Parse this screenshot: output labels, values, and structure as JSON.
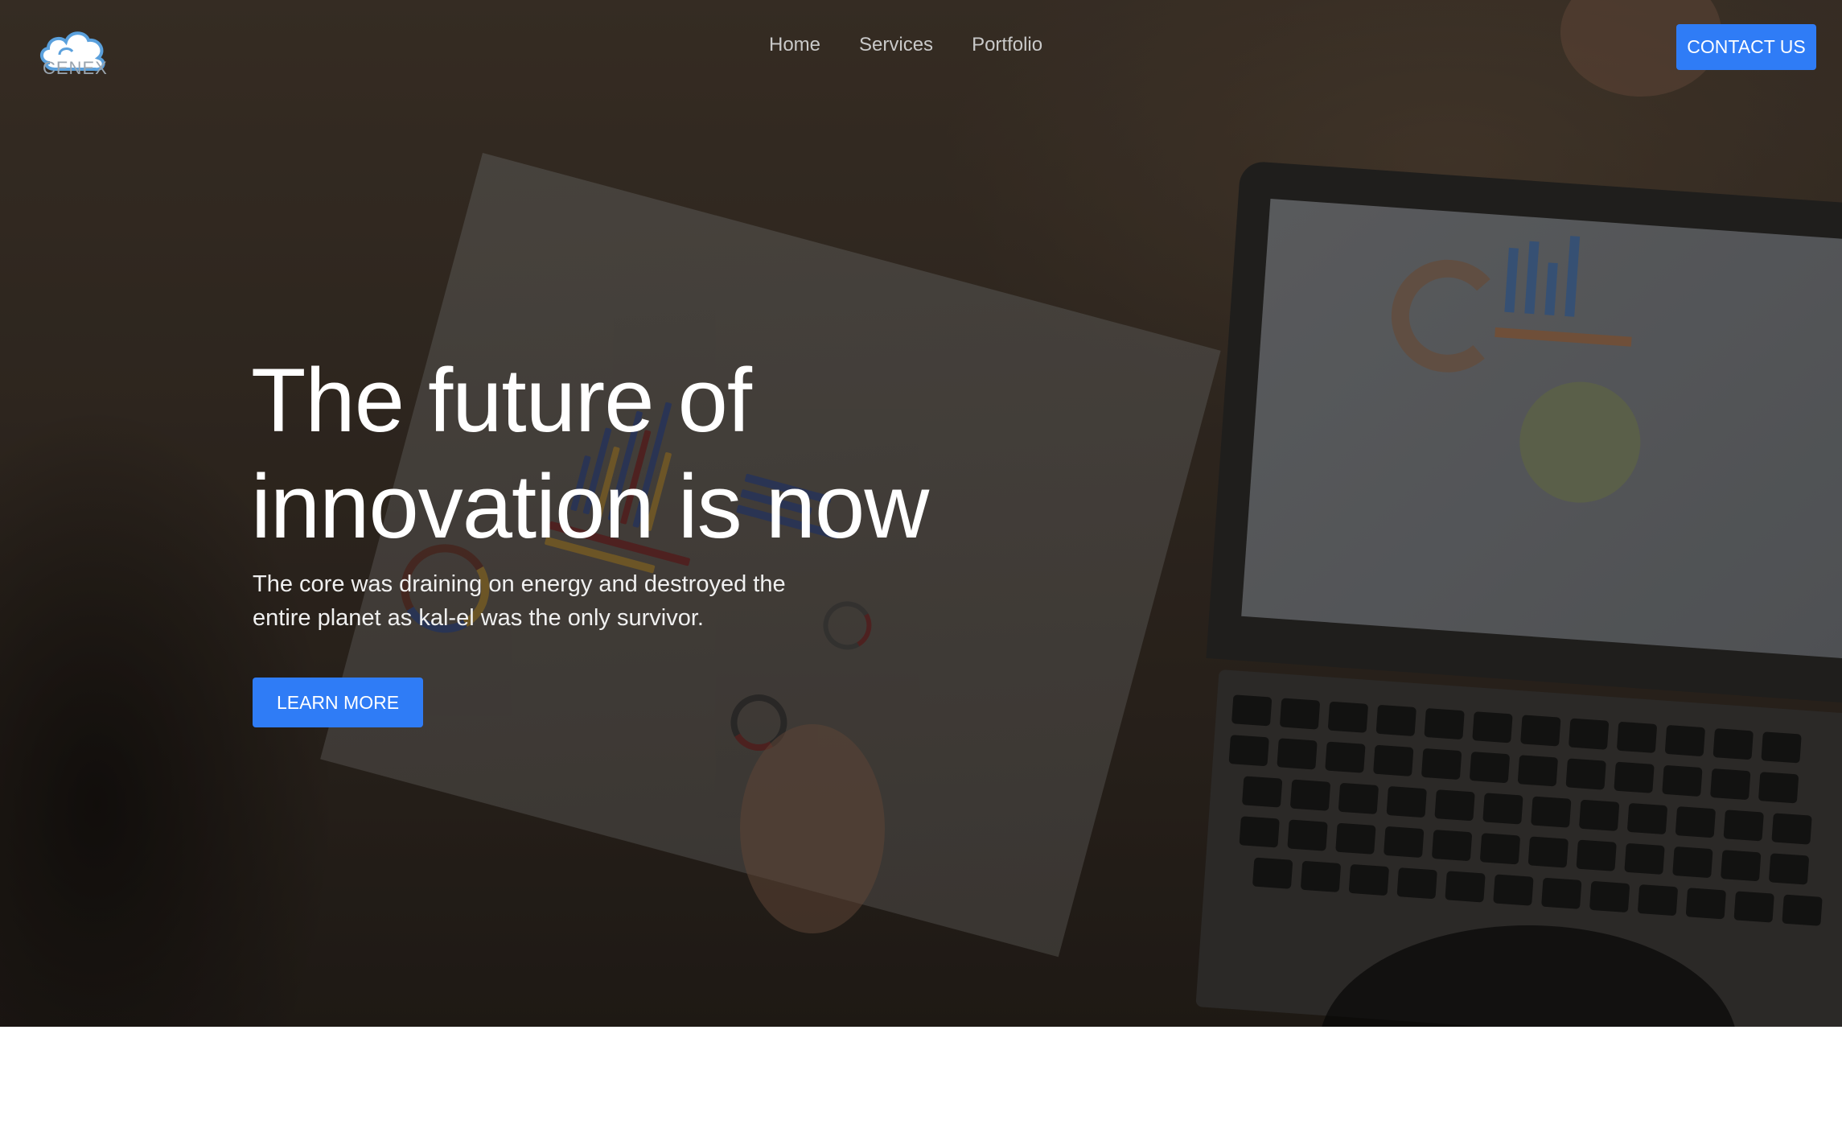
{
  "brand": {
    "logo_text": "CENEX",
    "logo_icon": "cloud-icon",
    "logo_color": "#5aa0dc"
  },
  "nav": {
    "items": [
      {
        "label": "Home"
      },
      {
        "label": "Services"
      },
      {
        "label": "Portfolio"
      }
    ],
    "contact_label": "CONTACT US"
  },
  "hero": {
    "headline_line1": "The future of",
    "headline_line2": "innovation is now",
    "subtext_line1": "The core was draining on energy and destroyed the",
    "subtext_line2": "entire planet as kal-el was the only survivor.",
    "cta_label": "LEARN MORE"
  },
  "colors": {
    "accent": "#2f7cf6",
    "hero_text": "#ffffff",
    "nav_text": "#c9c9c9"
  }
}
